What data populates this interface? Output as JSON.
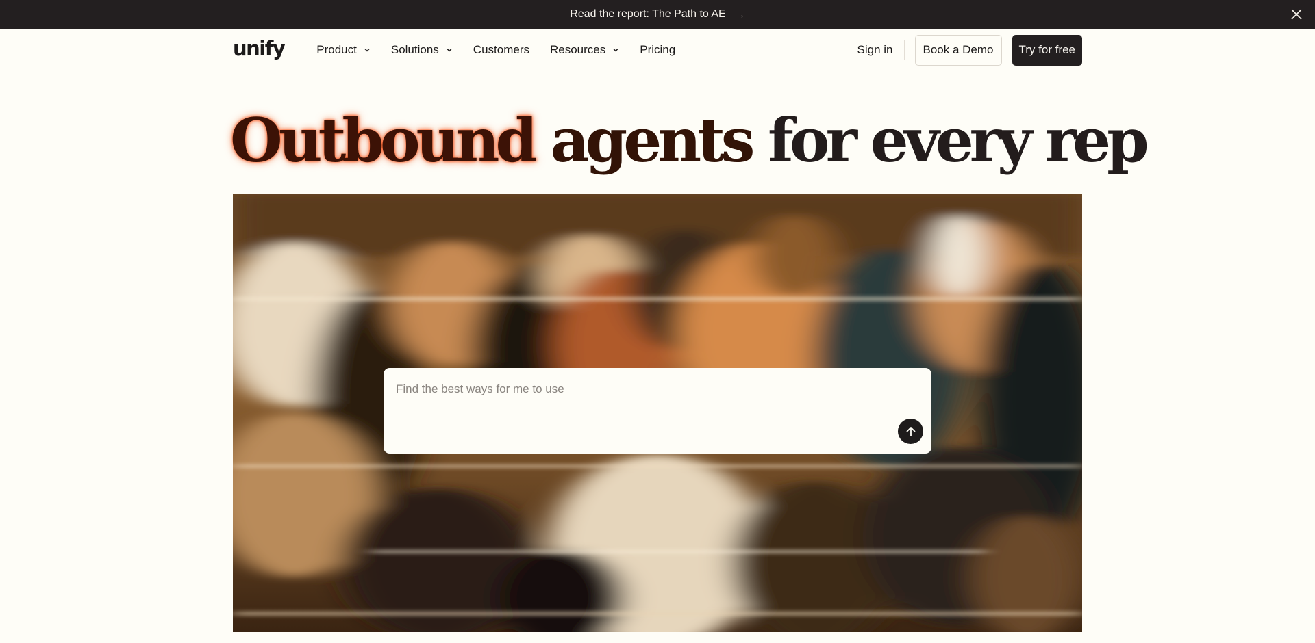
{
  "announcement": {
    "text": "Read the report: The Path to AE",
    "arrow": "→",
    "close_icon": "close-icon"
  },
  "header": {
    "logo": "unify",
    "nav": [
      {
        "label": "Product",
        "has_dropdown": true
      },
      {
        "label": "Solutions",
        "has_dropdown": true
      },
      {
        "label": "Customers",
        "has_dropdown": false
      },
      {
        "label": "Resources",
        "has_dropdown": true
      },
      {
        "label": "Pricing",
        "has_dropdown": false
      }
    ],
    "sign_in": "Sign in",
    "book_demo": "Book a Demo",
    "try_free": "Try for free"
  },
  "hero": {
    "word1": "Outbound",
    "word2": "agents",
    "rest": "for every rep"
  },
  "prompt": {
    "placeholder": "Find the best ways for me to use",
    "value": "",
    "send_icon": "arrow-up-icon"
  },
  "colors": {
    "background": "#fefdf7",
    "dark": "#231f20",
    "accent_glow": "#ff4a0a"
  }
}
